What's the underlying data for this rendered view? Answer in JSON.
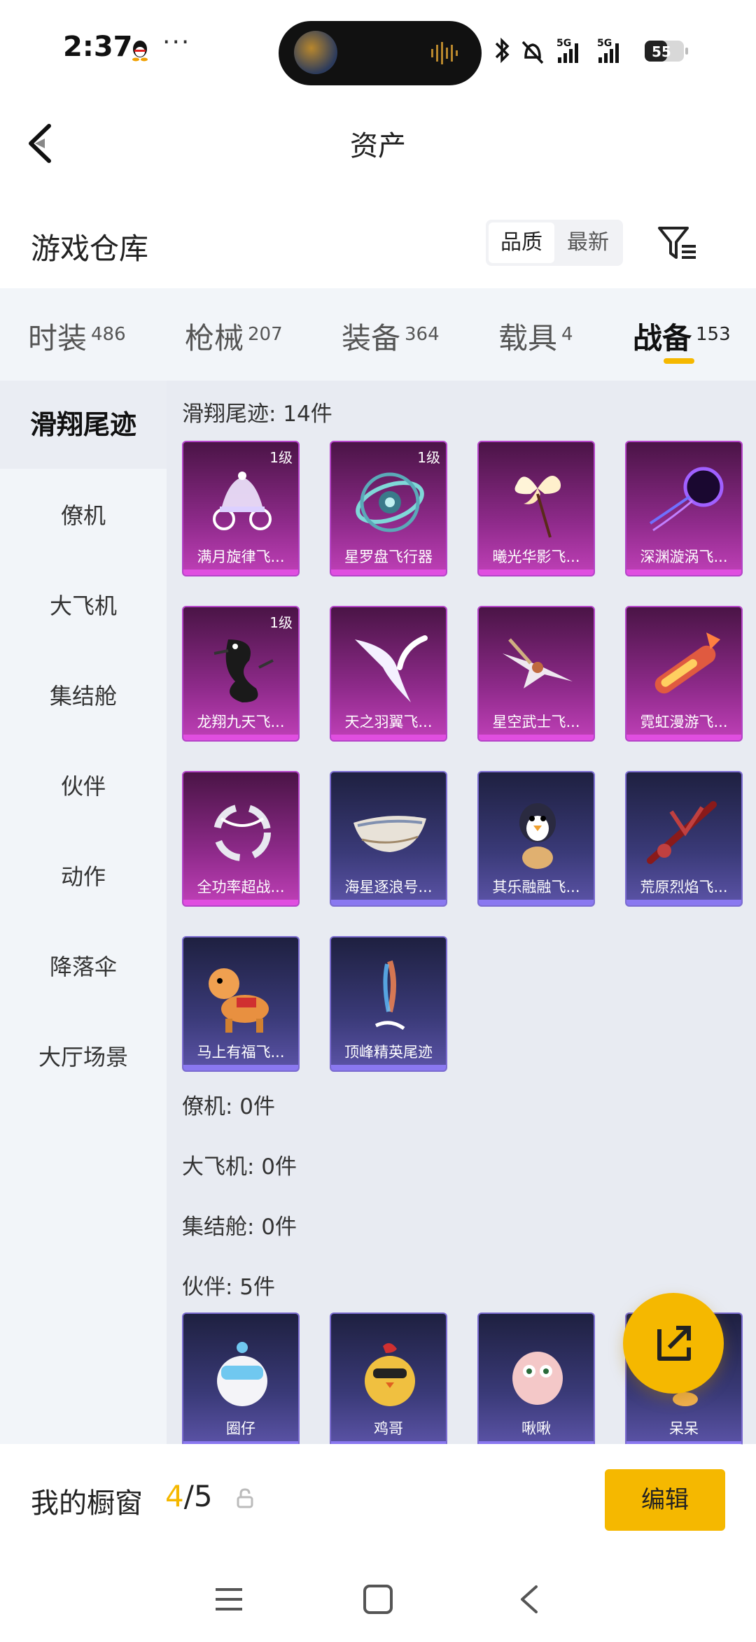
{
  "status_bar": {
    "time": "2:37",
    "more": "···",
    "battery": "55"
  },
  "header": {
    "title": "资产"
  },
  "warehouse": {
    "title": "游戏仓库",
    "sort_options": [
      "品质",
      "最新"
    ]
  },
  "tabs": [
    {
      "label": "时装",
      "count": "486"
    },
    {
      "label": "枪械",
      "count": "207"
    },
    {
      "label": "装备",
      "count": "364"
    },
    {
      "label": "载具",
      "count": "4"
    },
    {
      "label": "战备",
      "count": "153"
    }
  ],
  "sidebar": {
    "items": [
      "滑翔尾迹",
      "僚机",
      "大飞机",
      "集结舱",
      "伙伴",
      "动作",
      "降落伞",
      "大厅场景"
    ]
  },
  "sections": {
    "glide_trail": {
      "label": "滑翔尾迹: 14件",
      "items": [
        {
          "name": "满月旋律飞...",
          "level": "1级",
          "quality": "purple"
        },
        {
          "name": "星罗盘飞行器",
          "level": "1级",
          "quality": "purple"
        },
        {
          "name": "曦光华影飞...",
          "level": "",
          "quality": "purple"
        },
        {
          "name": "深渊漩涡飞...",
          "level": "",
          "quality": "purple"
        },
        {
          "name": "龙翔九天飞...",
          "level": "1级",
          "quality": "purple"
        },
        {
          "name": "天之羽翼飞...",
          "level": "",
          "quality": "purple"
        },
        {
          "name": "星空武士飞...",
          "level": "",
          "quality": "purple"
        },
        {
          "name": "霓虹漫游飞...",
          "level": "",
          "quality": "purple"
        },
        {
          "name": "全功率超战...",
          "level": "",
          "quality": "purple"
        },
        {
          "name": "海星逐浪号...",
          "level": "",
          "quality": "blue"
        },
        {
          "name": "其乐融融飞...",
          "level": "",
          "quality": "blue"
        },
        {
          "name": "荒原烈焰飞...",
          "level": "",
          "quality": "blue"
        },
        {
          "name": "马上有福飞...",
          "level": "",
          "quality": "blue"
        },
        {
          "name": "顶峰精英尾迹",
          "level": "",
          "quality": "blue"
        }
      ]
    },
    "wingman": {
      "label": "僚机: 0件"
    },
    "big_plane": {
      "label": "大飞机: 0件"
    },
    "pod": {
      "label": "集结舱: 0件"
    },
    "partner": {
      "label": "伙伴: 5件",
      "items": [
        {
          "name": "圈仔",
          "quality": "blue"
        },
        {
          "name": "鸡哥",
          "quality": "blue"
        },
        {
          "name": "啾啾",
          "quality": "blue"
        },
        {
          "name": "呆呆",
          "quality": "blue"
        }
      ]
    }
  },
  "showcase": {
    "label": "我的橱窗",
    "current": "4",
    "total": "/5",
    "edit_label": "编辑"
  },
  "colors": {
    "accent": "#f5b800",
    "purple_card": "#8e2a8a",
    "blue_card": "#3a3a78"
  }
}
